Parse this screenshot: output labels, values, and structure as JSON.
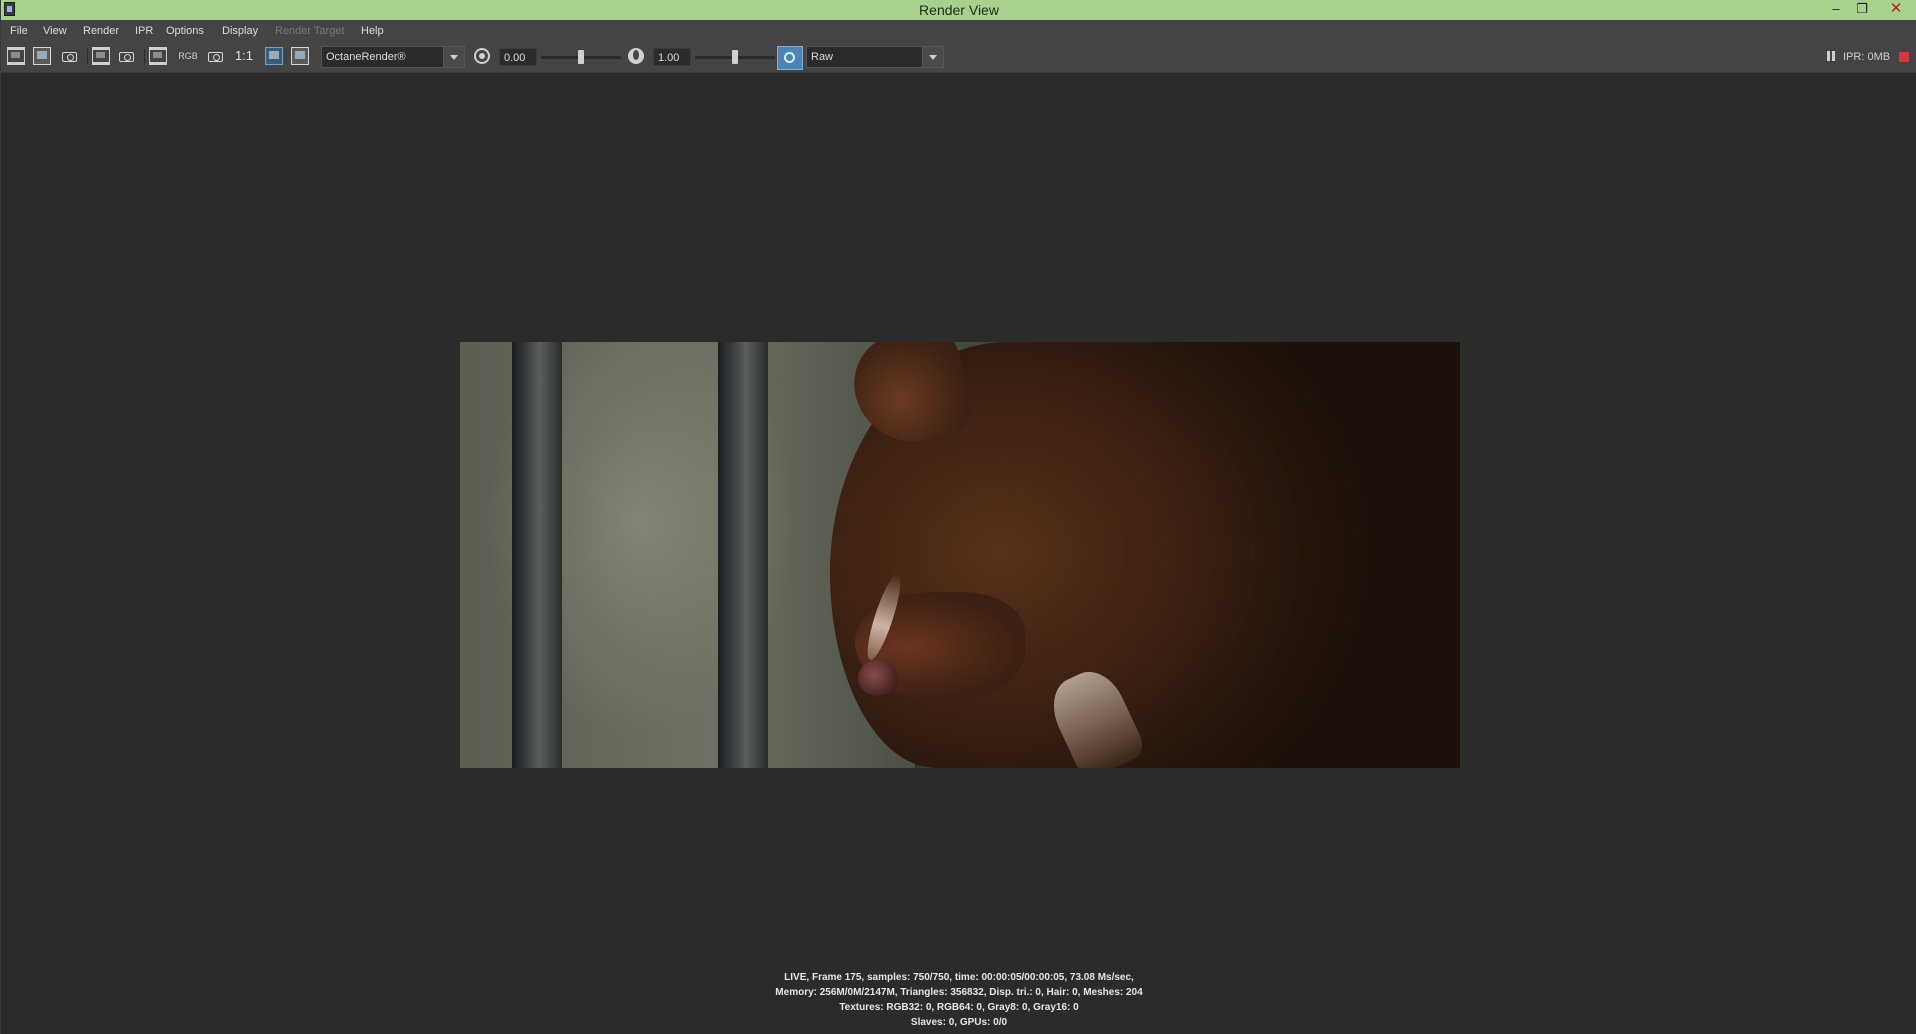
{
  "window": {
    "title": "Render View",
    "minimize": "–",
    "restore": "❐",
    "close": "✕"
  },
  "menu": {
    "items": [
      "File",
      "View",
      "Render",
      "IPR",
      "Options",
      "Display",
      "Render Target",
      "Help"
    ],
    "disabled": [
      "Render Target"
    ]
  },
  "toolbar": {
    "rgb_label": "RGB",
    "one_to_one_label": "1:1",
    "renderer": "OctaneRender®",
    "exposure_value": "0.00",
    "exposure_level": 0.5,
    "gamma_value": "1.00",
    "gamma_level": 0.5,
    "color_space": "Raw",
    "ipr_memory": "IPR: 0MB",
    "icons": [
      "render-frame-icon",
      "snapshot-icon",
      "camera-icon",
      "render-region-icon",
      "ipr-refresh-icon",
      "keep-image-icon",
      "rgb-channel-icon",
      "alpha-icon",
      "real-size-icon",
      "frame-image-icon",
      "remove-image-icon",
      "exposure-icon",
      "gamma-icon",
      "color-management-icon",
      "pause-icon",
      "stop-icon"
    ],
    "colors": {
      "title_bar": "#a9d18e",
      "panel": "#444444",
      "viewport": "#2b2b2b",
      "accent": "#4f83b3",
      "stop": "#d43a3a"
    }
  },
  "status": {
    "line1": "LIVE, Frame 175, samples: 750/750, time: 00:00:05/00:00:05, 73.08 Ms/sec,",
    "line2": "Memory: 256M/0M/2147M, Triangles: 356832, Disp. tri.: 0, Hair: 0, Meshes: 204",
    "line3": "Textures: RGB32: 0, RGB64: 0, Gray8: 0, Gray16: 0",
    "line4": "Slaves: 0, GPUs: 0/0"
  }
}
